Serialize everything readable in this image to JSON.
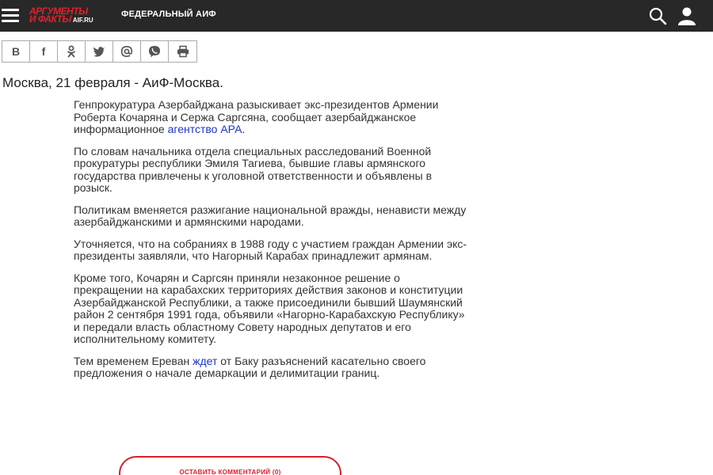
{
  "header": {
    "logo_line1": "АРГУМЕНТЫ",
    "logo_line2": "И ФАКТЫ",
    "logo_domain": "AIF.RU",
    "region_label": "ФЕДЕРАЛЬНЫЙ АИФ",
    "bg_color": "#282828",
    "brand_color": "#e3202a",
    "icons": [
      "menu-icon",
      "search-icon",
      "user-icon"
    ]
  },
  "share": {
    "vk_label": "В",
    "facebook_label": "f",
    "icons": [
      "vk-icon",
      "facebook-icon",
      "odnoklassniki-icon",
      "twitter-icon",
      "email-icon",
      "viber-icon",
      "print-icon"
    ]
  },
  "dateline": "Москва, 21 февраля - АиФ-Москва.",
  "article": {
    "p1_before": "Генпрокуратура Азербайджана разыскивает экс-президентов Армении Роберта Кочаряна и Сержа Саргсяна, сообщает азербайджанское информационное ",
    "p1_link": "агентство АРА",
    "p1_after": ".",
    "p2": "По словам начальника отдела специальных расследований Военной прокуратуры республики Эмиля Тагиева, бывшие главы армянского государства привлечены к уголовной ответственности и объявлены в розыск.",
    "p3": "Политикам вменяется разжигание национальной вражды, ненависти между азербайджанскими и армянскими народами.",
    "p4": "Уточняется, что на собраниях в 1988 году с участием граждан Армении экс-президенты заявляли, что Нагорный Карабах принадлежит армянам.",
    "p5": "Кроме того, Кочарян и Саргсян приняли незаконное решение о прекращении на карабахских территориях действия законов и конституции Азербайджанской Республики, а также присоединили бывший Шаумянский район 2 сентября 1991 года, объявили «Нагорно-Карабахскую Республику» и передали власть областному Совету народных депутатов и его исполнительному комитету.",
    "p6_before": "Тем временем Ереван ",
    "p6_link": "ждет",
    "p6_after": " от Баку разъяснений касательно своего предложения о начале демаркации и делимитации границ.",
    "link_color": "#1c35c8"
  },
  "comments": {
    "button_label": "ОСТАВИТЬ КОММЕНТАРИЙ (0)",
    "accent_color": "#d81e2c"
  }
}
